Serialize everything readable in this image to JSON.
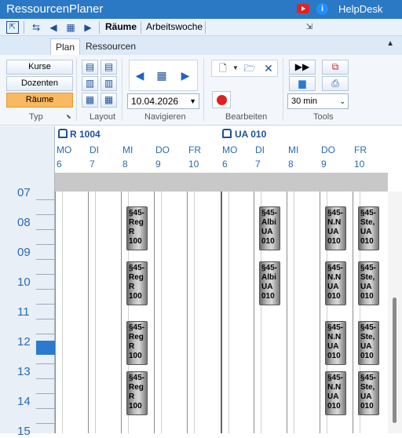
{
  "app": {
    "title": "RessourcenPlaner",
    "helpdesk": "HelpDesk",
    "youtube_icon": "youtube-icon",
    "info_icon": "info-icon",
    "brand_color": "#2b78c5"
  },
  "quickbar": {
    "view_raume": "Räume",
    "view_arbeitswoche": "Arbeitswoche"
  },
  "tabs": [
    {
      "label": "Plan",
      "active": true
    },
    {
      "label": "Ressourcen",
      "active": false
    }
  ],
  "ribbon": {
    "typ": {
      "label": "Typ",
      "buttons": [
        {
          "label": "Kurse",
          "selected": false
        },
        {
          "label": "Dozenten",
          "selected": false
        },
        {
          "label": "Räume",
          "selected": true
        }
      ]
    },
    "layout": {
      "label": "Layout"
    },
    "navigieren": {
      "label": "Navigieren",
      "date": "10.04.2026"
    },
    "bearbeiten": {
      "label": "Bearbeiten"
    },
    "tools": {
      "label": "Tools",
      "interval": "30 min"
    }
  },
  "calendar": {
    "resources": [
      {
        "name": "R 1004",
        "days": [
          {
            "name": "MO",
            "num": "6"
          },
          {
            "name": "DI",
            "num": "7"
          },
          {
            "name": "MI",
            "num": "8"
          },
          {
            "name": "DO",
            "num": "9"
          },
          {
            "name": "FR",
            "num": "10"
          }
        ]
      },
      {
        "name": "UA 010",
        "days": [
          {
            "name": "MO",
            "num": "6"
          },
          {
            "name": "DI",
            "num": "7"
          },
          {
            "name": "MI",
            "num": "8"
          },
          {
            "name": "DO",
            "num": "9"
          },
          {
            "name": "FR",
            "num": "10"
          }
        ]
      }
    ],
    "hours": [
      "07",
      "08",
      "09",
      "10",
      "11",
      "12",
      "13",
      "14",
      "15"
    ],
    "appointments": [
      {
        "lines": [
          "§45-",
          "Reg",
          "R",
          "100"
        ]
      },
      {
        "lines": [
          "§45-",
          "Reg",
          "R",
          "100"
        ]
      },
      {
        "lines": [
          "§45-",
          "Reg",
          "R",
          "100"
        ]
      },
      {
        "lines": [
          "§45-",
          "Reg",
          "R",
          "100"
        ]
      },
      {
        "lines": [
          "§45-",
          "Albi",
          "UA",
          "010"
        ]
      },
      {
        "lines": [
          "§45-",
          "Albi",
          "UA",
          "010"
        ]
      },
      {
        "lines": [
          "§45-",
          "N.N",
          "UA",
          "010"
        ]
      },
      {
        "lines": [
          "§45-",
          "N.N",
          "UA",
          "010"
        ]
      },
      {
        "lines": [
          "§45-",
          "N.N",
          "UA",
          "010"
        ]
      },
      {
        "lines": [
          "§45-",
          "N.N",
          "UA",
          "010"
        ]
      },
      {
        "lines": [
          "§45-",
          "Ste,",
          "UA",
          "010"
        ]
      },
      {
        "lines": [
          "§45-",
          "Ste,",
          "UA",
          "010"
        ]
      },
      {
        "lines": [
          "§45-",
          "Ste,",
          "UA",
          "010"
        ]
      },
      {
        "lines": [
          "§45-",
          "Ste,",
          "UA",
          "010"
        ]
      }
    ]
  }
}
